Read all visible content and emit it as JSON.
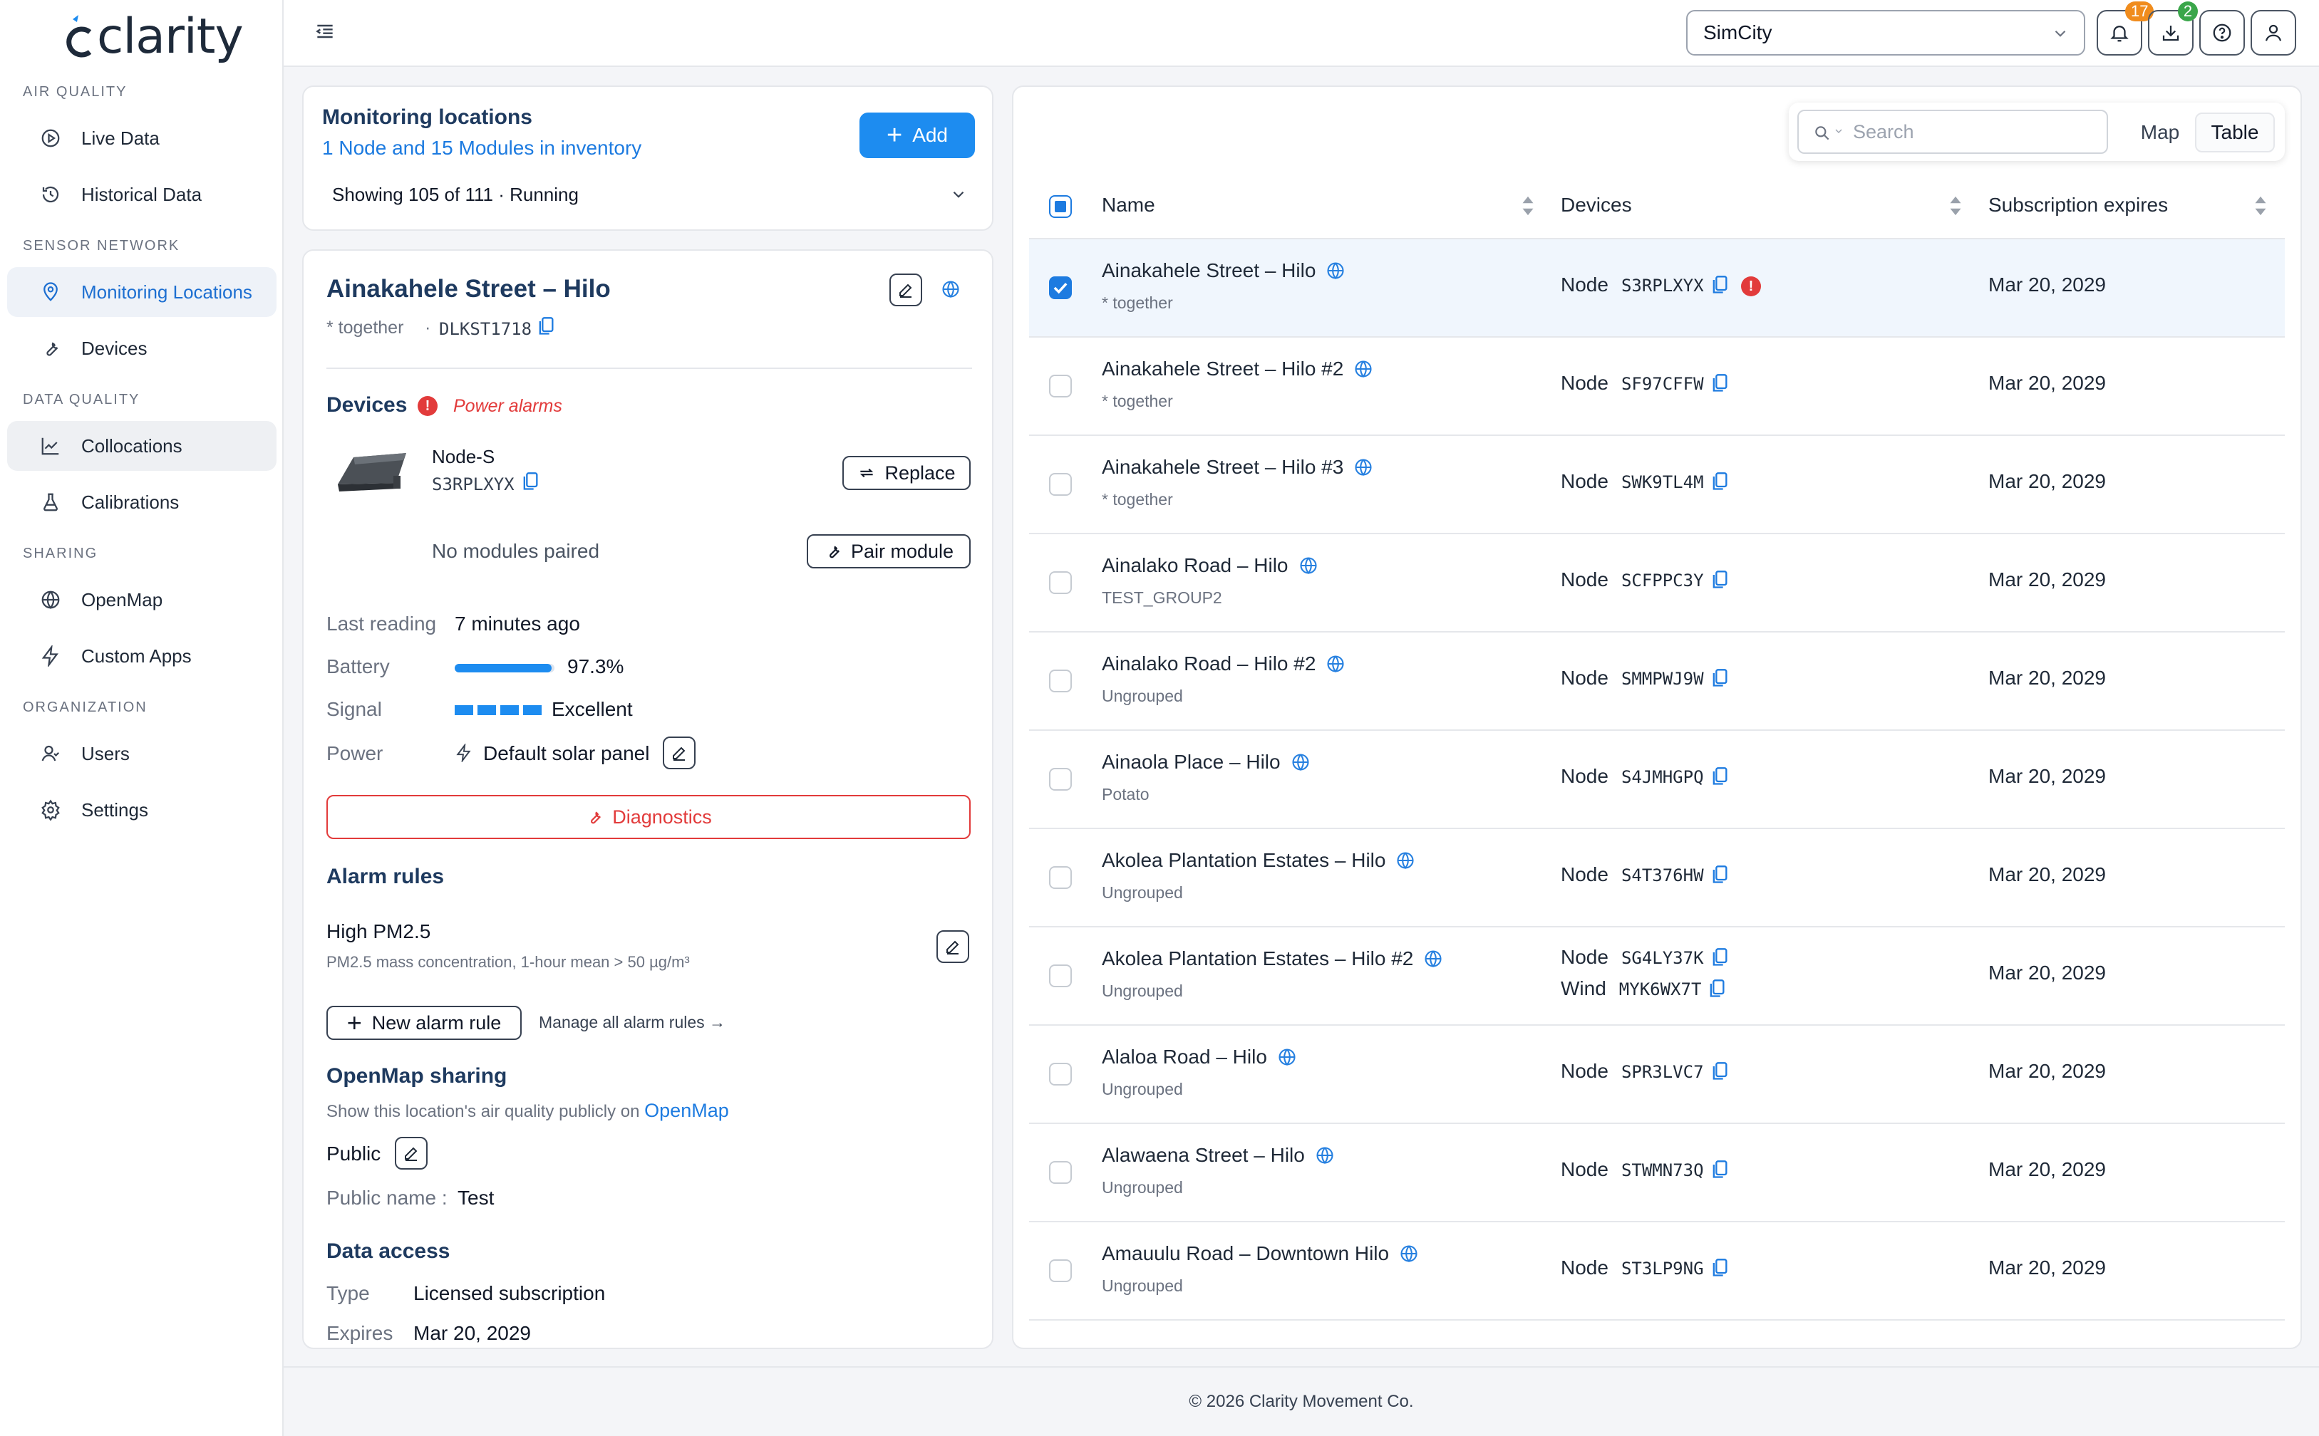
{
  "brand": {
    "name": "clarity"
  },
  "sidebar": {
    "sections": [
      {
        "title": "Air Quality",
        "items": [
          {
            "label": "Live Data",
            "icon": "play-circle-icon"
          },
          {
            "label": "Historical Data",
            "icon": "history-icon"
          }
        ]
      },
      {
        "title": "Sensor Network",
        "items": [
          {
            "label": "Monitoring Locations",
            "icon": "map-pin-icon"
          },
          {
            "label": "Devices",
            "icon": "wrench-icon"
          }
        ]
      },
      {
        "title": "Data Quality",
        "items": [
          {
            "label": "Collocations",
            "icon": "line-chart-icon"
          },
          {
            "label": "Calibrations",
            "icon": "flask-icon"
          }
        ]
      },
      {
        "title": "Sharing",
        "items": [
          {
            "label": "OpenMap",
            "icon": "globe-icon"
          },
          {
            "label": "Custom Apps",
            "icon": "bolt-icon"
          }
        ]
      },
      {
        "title": "Organization",
        "items": [
          {
            "label": "Users",
            "icon": "users-icon"
          },
          {
            "label": "Settings",
            "icon": "gear-icon"
          }
        ]
      }
    ],
    "active_item": "Monitoring Locations"
  },
  "topbar": {
    "org_select": {
      "value": "SimCity"
    },
    "notifications_count": "17",
    "downloads_count": "2"
  },
  "summary": {
    "title": "Monitoring locations",
    "inventory_link": "1 Node and 15 Modules in inventory",
    "add_label": "Add",
    "showing": "Showing 105 of 111 · Running"
  },
  "detail": {
    "name": "Ainakahele Street – Hilo",
    "group": "* together",
    "separator": "·",
    "code": "DLKST1718",
    "devices_title": "Devices",
    "alarm_text": "Power alarms",
    "device_model": "Node-S",
    "device_serial": "S3RPLXYX",
    "replace_label": "Replace",
    "no_modules": "No modules paired",
    "pair_label": "Pair module",
    "stats": {
      "last_reading_label": "Last reading",
      "last_reading_value": "7 minutes ago",
      "battery_label": "Battery",
      "battery_value": "97.3%",
      "battery_fraction": 0.973,
      "signal_label": "Signal",
      "signal_value": "Excellent",
      "signal_bars": 4,
      "power_label": "Power",
      "power_value": "Default solar panel"
    },
    "diagnostics_label": "Diagnostics",
    "alarm_rules_title": "Alarm rules",
    "rule_name": "High PM2.5",
    "rule_desc": "PM2.5 mass concentration, 1-hour mean > 50 µg/m³",
    "new_rule_label": "New alarm rule",
    "manage_rules_label": "Manage all alarm rules →",
    "openmap_title": "OpenMap sharing",
    "openmap_desc": "Show this location's air quality publicly on",
    "openmap_link": "OpenMap",
    "public_label": "Public",
    "public_name_label": "Public name :",
    "public_name_value": "Test",
    "data_access_title": "Data access",
    "type_label": "Type",
    "type_value": "Licensed subscription",
    "expires_label": "Expires",
    "expires_value": "Mar 20, 2029"
  },
  "table": {
    "search_placeholder": "Search",
    "view_map": "Map",
    "view_table": "Table",
    "columns": [
      "Name",
      "Devices",
      "Subscription expires"
    ],
    "rows": [
      {
        "name": "Ainakahele Street – Hilo",
        "group": "* together",
        "devices": [
          {
            "type": "Node",
            "id": "S3RPLXYX"
          }
        ],
        "alert": true,
        "expires": "Mar 20, 2029",
        "selected": true
      },
      {
        "name": "Ainakahele Street – Hilo #2",
        "group": "* together",
        "devices": [
          {
            "type": "Node",
            "id": "SF97CFFW"
          }
        ],
        "expires": "Mar 20, 2029"
      },
      {
        "name": "Ainakahele Street – Hilo #3",
        "group": "* together",
        "devices": [
          {
            "type": "Node",
            "id": "SWK9TL4M"
          }
        ],
        "expires": "Mar 20, 2029"
      },
      {
        "name": "Ainalako Road – Hilo",
        "group": "TEST_GROUP2",
        "devices": [
          {
            "type": "Node",
            "id": "SCFPPC3Y"
          }
        ],
        "expires": "Mar 20, 2029"
      },
      {
        "name": "Ainalako Road – Hilo #2",
        "group": "Ungrouped",
        "devices": [
          {
            "type": "Node",
            "id": "SMMPWJ9W"
          }
        ],
        "expires": "Mar 20, 2029"
      },
      {
        "name": "Ainaola Place – Hilo",
        "group": "Potato",
        "devices": [
          {
            "type": "Node",
            "id": "S4JMHGPQ"
          }
        ],
        "expires": "Mar 20, 2029"
      },
      {
        "name": "Akolea Plantation Estates – Hilo",
        "group": "Ungrouped",
        "devices": [
          {
            "type": "Node",
            "id": "S4T376HW"
          }
        ],
        "expires": "Mar 20, 2029"
      },
      {
        "name": "Akolea Plantation Estates – Hilo #2",
        "group": "Ungrouped",
        "devices": [
          {
            "type": "Node",
            "id": "SG4LY37K"
          },
          {
            "type": "Wind",
            "id": "MYK6WX7T"
          }
        ],
        "expires": "Mar 20, 2029"
      },
      {
        "name": "Alaloa Road – Hilo",
        "group": "Ungrouped",
        "devices": [
          {
            "type": "Node",
            "id": "SPR3LVC7"
          }
        ],
        "expires": "Mar 20, 2029"
      },
      {
        "name": "Alawaena Street – Hilo",
        "group": "Ungrouped",
        "devices": [
          {
            "type": "Node",
            "id": "STWMN73Q"
          }
        ],
        "expires": "Mar 20, 2029"
      },
      {
        "name": "Amauulu Road – Downtown Hilo",
        "group": "Ungrouped",
        "devices": [
          {
            "type": "Node",
            "id": "ST3LP9NG"
          }
        ],
        "expires": "Mar 20, 2029"
      }
    ]
  },
  "footer": {
    "text": "© 2026 Clarity Movement Co."
  },
  "colors": {
    "primary": "#1d8cf0",
    "accent": "#1d7be0",
    "danger": "#e23b3b",
    "notification_badge": "#f08c1d",
    "download_badge": "#3aa64a",
    "heading": "#1e3a5f"
  }
}
